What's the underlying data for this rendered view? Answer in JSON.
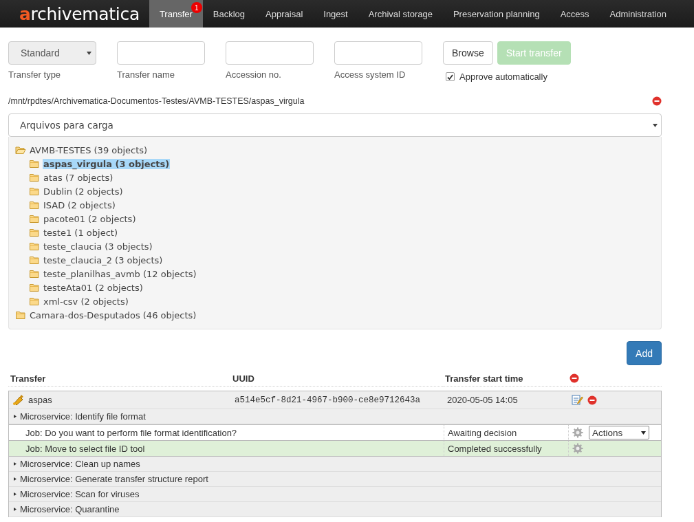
{
  "logo": {
    "accent": "a",
    "rest": "rchivematica"
  },
  "nav": [
    {
      "label": "Transfer",
      "selected": true,
      "badge": "1"
    },
    {
      "label": "Backlog",
      "selected": false
    },
    {
      "label": "Appraisal",
      "selected": false
    },
    {
      "label": "Ingest",
      "selected": false
    },
    {
      "label": "Archival storage",
      "selected": false
    },
    {
      "label": "Preservation planning",
      "selected": false
    },
    {
      "label": "Access",
      "selected": false
    },
    {
      "label": "Administration",
      "selected": false
    }
  ],
  "form": {
    "transfer_type": {
      "value": "Standard",
      "label": "Transfer type"
    },
    "fields": [
      {
        "label": "Transfer name"
      },
      {
        "label": "Accession no."
      },
      {
        "label": "Access system ID"
      }
    ],
    "browse_button": "Browse",
    "start_button": {
      "label": "Start transfer",
      "disabled": true
    },
    "approve": {
      "label": "Approve automatically",
      "checked": true
    }
  },
  "path": "/mnt/rpdtes/Archivematica-Documentos-Testes/AVMB-TESTES/aspas_virgula",
  "location_select": "Arquivos para carga",
  "tree": [
    {
      "label": "AVMB-TESTES (39 objects)",
      "expanded": true,
      "selected": false,
      "children": [
        {
          "label": "aspas_virgula (3 objects)",
          "expanded": false,
          "selected": true
        },
        {
          "label": "atas (7 objects)",
          "expanded": false,
          "selected": false
        },
        {
          "label": "Dublin (2 objects)",
          "expanded": false,
          "selected": false
        },
        {
          "label": "ISAD (2 objects)",
          "expanded": false,
          "selected": false
        },
        {
          "label": "pacote01 (2 objects)",
          "expanded": false,
          "selected": false
        },
        {
          "label": "teste1 (1 object)",
          "expanded": false,
          "selected": false
        },
        {
          "label": "teste_claucia (3 objects)",
          "expanded": false,
          "selected": false
        },
        {
          "label": "teste_claucia_2 (3 objects)",
          "expanded": false,
          "selected": false
        },
        {
          "label": "teste_planilhas_avmb (12 objects)",
          "expanded": false,
          "selected": false
        },
        {
          "label": "testeAta01 (2 objects)",
          "expanded": false,
          "selected": false
        },
        {
          "label": "xml-csv (2 objects)",
          "expanded": false,
          "selected": false
        }
      ]
    },
    {
      "label": "Camara-dos-Desputados (46 objects)",
      "expanded": false,
      "selected": false
    }
  ],
  "add_button": "Add",
  "table": {
    "columns": [
      "Transfer",
      "UUID",
      "Transfer start time"
    ],
    "transfers": [
      {
        "name": "aspas",
        "uuid": "a514e5cf-8d21-4967-b900-ce8e9712643a",
        "start_time": "2020-05-05 14:05",
        "microservices": [
          {
            "label": "Microservice: Identify file format",
            "jobs": [
              {
                "label": "Job: Do you want to perform file format identification?",
                "status": "Awaiting decision",
                "kind": "awaiting",
                "actions": "Actions"
              },
              {
                "label": "Job: Move to select file ID tool",
                "status": "Completed successfully",
                "kind": "completed"
              }
            ]
          },
          {
            "label": "Microservice: Clean up names"
          },
          {
            "label": "Microservice: Generate transfer structure report"
          },
          {
            "label": "Microservice: Scan for viruses"
          },
          {
            "label": "Microservice: Quarantine"
          }
        ]
      }
    ]
  }
}
